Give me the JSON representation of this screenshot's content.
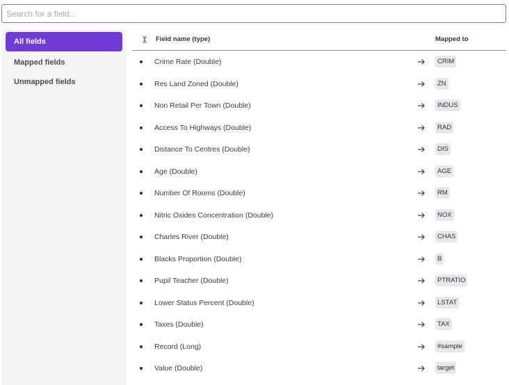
{
  "search": {
    "placeholder": "Search for a field...",
    "value": ""
  },
  "sidebar": {
    "items": [
      {
        "label": "All fields",
        "active": true
      },
      {
        "label": "Mapped fields",
        "active": false
      },
      {
        "label": "Unmapped fields",
        "active": false
      }
    ]
  },
  "table": {
    "headers": {
      "field_name": "Field name (type)",
      "mapped_to": "Mapped to"
    },
    "rows": [
      {
        "field": "Crime Rate (Double)",
        "mapped": "CRIM"
      },
      {
        "field": "Res Land Zoned (Double)",
        "mapped": "ZN"
      },
      {
        "field": "Non Retail Per Town (Double)",
        "mapped": "INDUS"
      },
      {
        "field": "Access To Highways (Double)",
        "mapped": "RAD"
      },
      {
        "field": "Distance To Centres (Double)",
        "mapped": "DIS"
      },
      {
        "field": "Age (Double)",
        "mapped": "AGE"
      },
      {
        "field": "Number Of Rooms (Double)",
        "mapped": "RM"
      },
      {
        "field": "Nitric Oxides Concentration (Double)",
        "mapped": "NOX"
      },
      {
        "field": "Charles River (Double)",
        "mapped": "CHAS"
      },
      {
        "field": "Blacks Proportion (Double)",
        "mapped": "B"
      },
      {
        "field": "Pupil Teacher (Double)",
        "mapped": "PTRATIO"
      },
      {
        "field": "Lower Status Percent (Double)",
        "mapped": "LSTAT"
      },
      {
        "field": "Taxes (Double)",
        "mapped": "TAX"
      },
      {
        "field": "Record (Long)",
        "mapped": "#sample"
      },
      {
        "field": "Value (Double)",
        "mapped": "target"
      }
    ]
  },
  "colors": {
    "accent": "#6e3bd6",
    "search_border": "#8e6adf",
    "sidebar_bg": "#f4f4f5",
    "badge_bg": "#e8e8ec"
  },
  "icons": {
    "sort": "sort-icon",
    "arrow": "arrow-right-icon",
    "bullet": "bullet-icon"
  }
}
